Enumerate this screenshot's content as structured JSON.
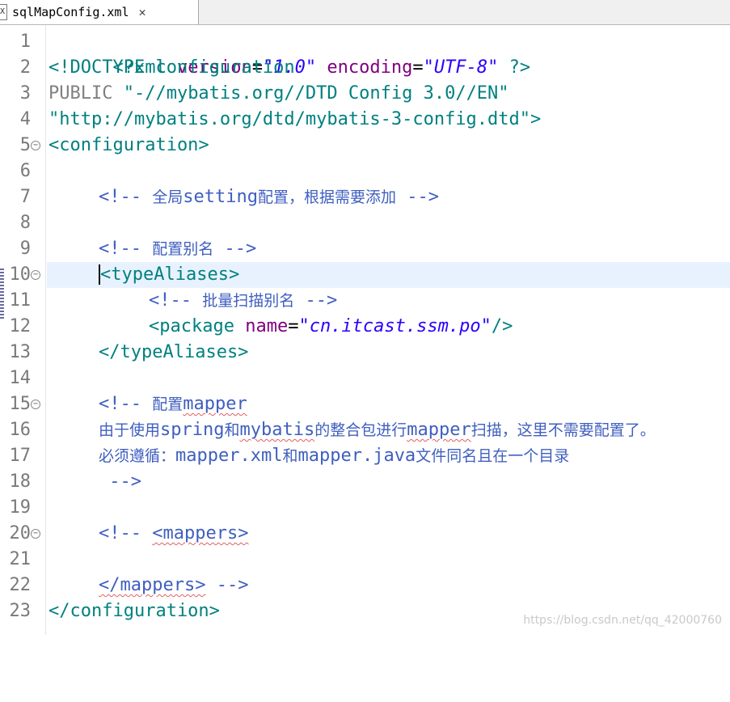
{
  "tab": {
    "title": "sqlMapConfig.xml",
    "icon": "xml-file-icon",
    "icon_glyph": "X",
    "close_glyph": "✕"
  },
  "lines": [
    {
      "n": "1",
      "fold": false
    },
    {
      "n": "2",
      "fold": false
    },
    {
      "n": "3",
      "fold": false
    },
    {
      "n": "4",
      "fold": false
    },
    {
      "n": "5",
      "fold": true
    },
    {
      "n": "6",
      "fold": false
    },
    {
      "n": "7",
      "fold": false
    },
    {
      "n": "8",
      "fold": false
    },
    {
      "n": "9",
      "fold": false
    },
    {
      "n": "10",
      "fold": true
    },
    {
      "n": "11",
      "fold": false
    },
    {
      "n": "12",
      "fold": false
    },
    {
      "n": "13",
      "fold": false
    },
    {
      "n": "14",
      "fold": false
    },
    {
      "n": "15",
      "fold": true
    },
    {
      "n": "16",
      "fold": false
    },
    {
      "n": "17",
      "fold": false
    },
    {
      "n": "18",
      "fold": false
    },
    {
      "n": "19",
      "fold": false
    },
    {
      "n": "20",
      "fold": true
    },
    {
      "n": "21",
      "fold": false
    },
    {
      "n": "22",
      "fold": false
    },
    {
      "n": "23",
      "fold": false
    }
  ],
  "code": {
    "l1_open": "<?xml ",
    "l1_attr1": "version",
    "l1_eq1": "=",
    "l1_val1": "\"1.0\"",
    "l1_attr2": "encoding",
    "l1_eq2": "=",
    "l1_val2": "\"UTF-8\"",
    "l1_close": " ?>",
    "l2": "<!DOCTYPE configuration",
    "l3_a": "PUBLIC ",
    "l3_b": "\"-//mybatis.org//DTD Config 3.0//EN\"",
    "l4": "\"http://mybatis.org/dtd/mybatis-3-config.dtd\">",
    "l5": "<configuration>",
    "l7_a": "<!-- ",
    "l7_b": "全局",
    "l7_c": "setting",
    "l7_d": "配置，根据需要添加",
    "l7_e": " -->",
    "l9_a": "<!-- ",
    "l9_b": "配置别名",
    "l9_c": " -->",
    "l10": "<typeAliases>",
    "l11_a": "<!-- ",
    "l11_b": "批量扫描别名",
    "l11_c": " -->",
    "l12_open": "<package ",
    "l12_attr": "name",
    "l12_eq": "=",
    "l12_val": "\"cn.itcast.ssm.po\"",
    "l12_close": "/>",
    "l13": "</typeAliases>",
    "l15_a": "<!-- ",
    "l15_b": "配置",
    "l15_c": "mapper",
    "l16_a": "由于使用",
    "l16_b": "spring",
    "l16_c": "和",
    "l16_d": "mybatis",
    "l16_e": "的整合包进行",
    "l16_f": "mapper",
    "l16_g": "扫描，这里不需要配置了。",
    "l17_a": "必须遵循：",
    "l17_b": "mapper.xml",
    "l17_c": "和",
    "l17_d": "mapper.java",
    "l17_e": "文件同名且在一个目录",
    "l18": " -->",
    "l20_a": "<!-- ",
    "l20_b": "<mappers>",
    "l22_a": "</mappers>",
    "l22_b": " -->",
    "l23": "</configuration>"
  },
  "colors": {
    "tag": "#008080",
    "attribute": "#7f007f",
    "value": "#2a00ff",
    "comment": "#3f5fbf",
    "current_line": "#e8f2fe"
  },
  "watermark": "https://blog.csdn.net/qq_42000760"
}
